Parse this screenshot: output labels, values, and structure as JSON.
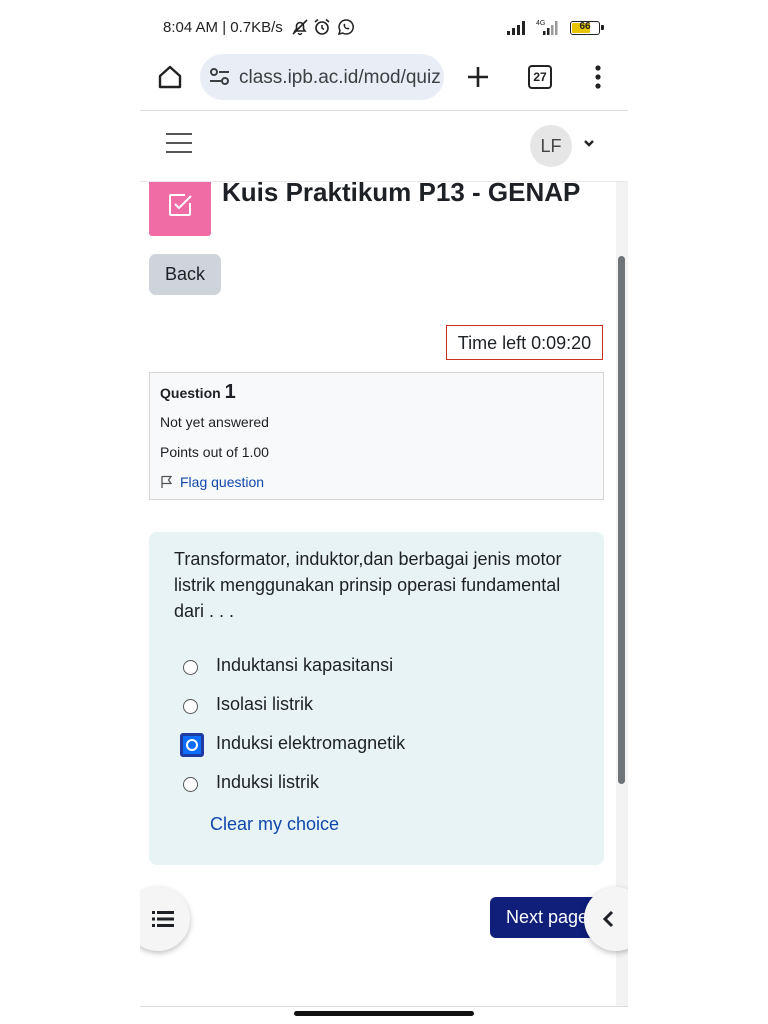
{
  "status_bar": {
    "time": "8:04 AM | 0.7KB/s",
    "network_label": "4G",
    "battery": "66"
  },
  "browser": {
    "url": "class.ipb.ac.id/mod/quiz",
    "tab_count": "27"
  },
  "header": {
    "avatar_initials": "LF"
  },
  "page": {
    "title": "Kuis Praktikum P13 - GENAP",
    "back_label": "Back",
    "timer": "Time left 0:09:20"
  },
  "question_info": {
    "label": "Question",
    "number": "1",
    "state": "Not yet answered",
    "grade": "Points out of 1.00",
    "flag_label": "Flag question"
  },
  "question": {
    "text": "Transformator, induktor,dan berbagai jenis motor listrik menggunakan prinsip operasi fundamental dari . . .",
    "options": [
      {
        "label": "Induktansi kapasitansi",
        "selected": false
      },
      {
        "label": "Isolasi listrik",
        "selected": false
      },
      {
        "label": "Induksi elektromagnetik",
        "selected": true
      },
      {
        "label": "Induksi listrik",
        "selected": false
      }
    ],
    "clear_label": "Clear my choice"
  },
  "footer": {
    "next_label": "Next page"
  },
  "colors": {
    "accent": "#0f1f7a",
    "link": "#0f47ad",
    "quiz_icon": "#f06ca4",
    "timer_border": "#ca3120",
    "formulation_bg": "#e7f3f5"
  },
  "icons": [
    "silent-bell-icon",
    "alarm-icon",
    "whatsapp-icon",
    "signal-icon",
    "battery-icon",
    "home-icon",
    "site-settings-icon",
    "plus-icon",
    "more-vert-icon",
    "hamburger-icon",
    "chevron-down-icon",
    "checkbox-edit-icon",
    "flag-icon",
    "list-icon",
    "chevron-left-icon"
  ]
}
